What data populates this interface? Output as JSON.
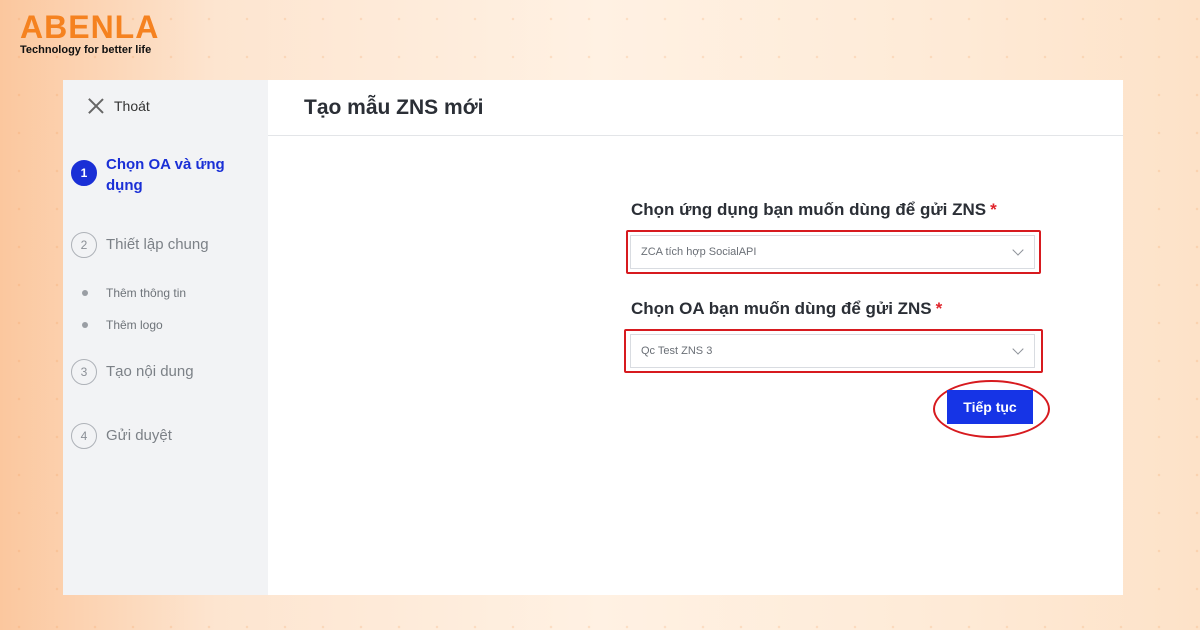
{
  "brand": {
    "name": "ABENLA",
    "tagline": "Technology for better life",
    "accent_color": "#f58220"
  },
  "sidebar": {
    "exit_label": "Thoát",
    "steps": [
      {
        "num": "1",
        "label": "Chọn OA và ứng dụng",
        "active": true
      },
      {
        "num": "2",
        "label": "Thiết lập chung",
        "active": false
      },
      {
        "num": "3",
        "label": "Tạo nội dung",
        "active": false
      },
      {
        "num": "4",
        "label": "Gửi duyệt",
        "active": false
      }
    ],
    "substeps": [
      "Thêm thông tin",
      "Thêm logo"
    ]
  },
  "main": {
    "title": "Tạo mẫu ZNS mới",
    "app_field": {
      "label": "Chọn ứng dụng bạn muốn dùng để gửi ZNS",
      "required": "*",
      "value": "ZCA tích hợp SocialAPI"
    },
    "oa_field": {
      "label": "Chọn OA bạn muốn dùng để gửi ZNS",
      "required": "*",
      "value": "Qc Test ZNS 3"
    },
    "next_button": "Tiếp tục"
  },
  "colors": {
    "primary": "#1634e6",
    "highlight": "#d71a1f"
  }
}
